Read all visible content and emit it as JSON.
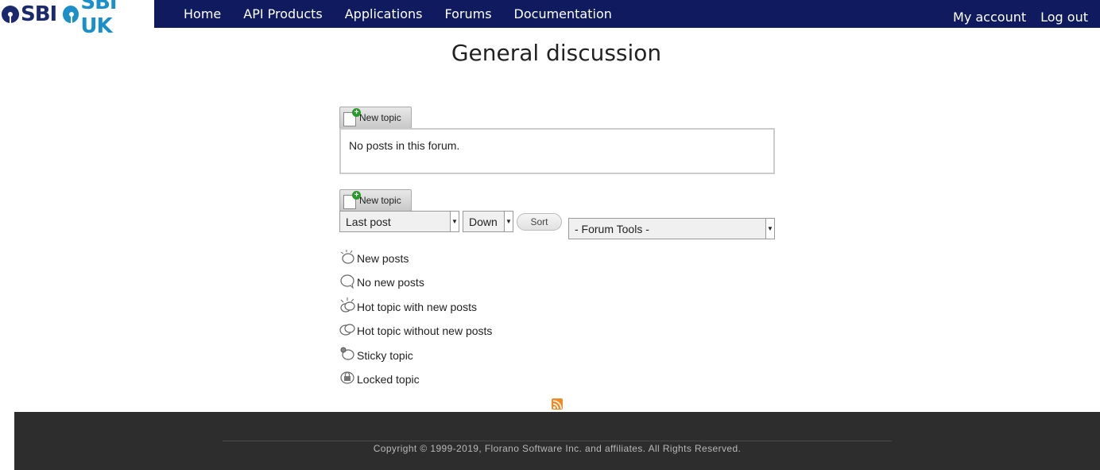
{
  "header": {
    "logos": [
      {
        "text": "SBI",
        "color": "#1a2a6c"
      },
      {
        "text": "SBI UK",
        "color": "#1a8fc9"
      }
    ],
    "nav": [
      "Home",
      "API Products",
      "Applications",
      "Forums",
      "Documentation"
    ],
    "account": {
      "my_account": "My account",
      "logout": "Log out"
    }
  },
  "page": {
    "title": "General discussion",
    "new_topic_label": "New topic",
    "empty_message": "No posts in this forum."
  },
  "controls": {
    "sort_by": "Last post",
    "order": "Down",
    "sort_label": "Sort",
    "forum_tools": "- Forum Tools -"
  },
  "legend": [
    {
      "label": "New posts",
      "icon": "new-posts-icon"
    },
    {
      "label": "No new posts",
      "icon": "no-new-posts-icon"
    },
    {
      "label": "Hot topic with new posts",
      "icon": "hot-topic-new-icon"
    },
    {
      "label": "Hot topic without new posts",
      "icon": "hot-topic-icon"
    },
    {
      "label": "Sticky topic",
      "icon": "sticky-topic-icon"
    },
    {
      "label": "Locked topic",
      "icon": "locked-topic-icon"
    }
  ],
  "footer": {
    "copyright": "Copyright © 1999-2019, Florano Software Inc. and affiliates. All Rights Reserved."
  },
  "colors": {
    "navbar": "#0f1b5e",
    "footer": "#2d2d2d",
    "rss": "#f08a24"
  }
}
